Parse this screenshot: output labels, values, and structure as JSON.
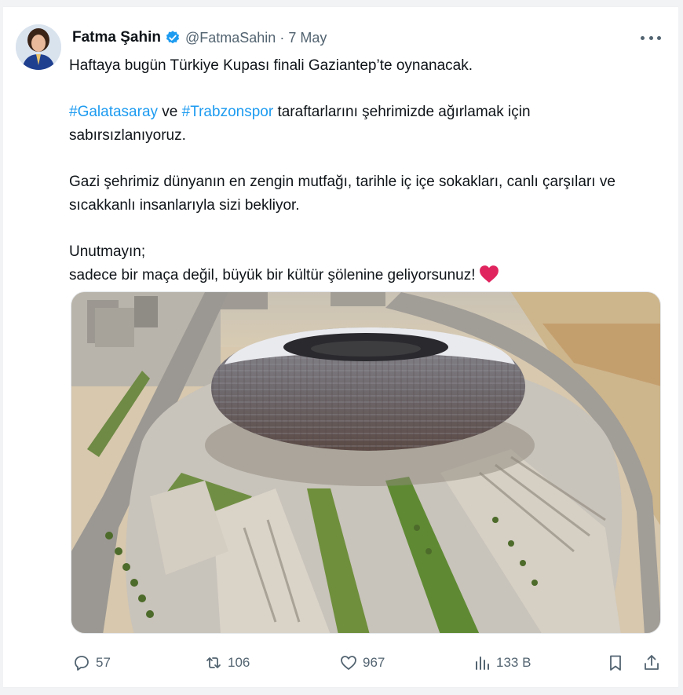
{
  "tweet": {
    "author_name": "Fatma Şahin",
    "handle": "@FatmaSahin",
    "separator": "·",
    "date": "7 May",
    "verified": true,
    "lines": {
      "p1": "Haftaya bugün Türkiye Kupası finali Gaziantep’te oynanacak.",
      "hashtag1": "#Galatasaray",
      "conj": " ve ",
      "hashtag2": "#Trabzonspor",
      "p2_rest": " taraftarlarını şehrimizde ağırlamak için sabırsızlanıyoruz.",
      "p3": "Gazi şehrimiz dünyanın en zengin mutfağı, tarihle iç içe sokakları, canlı çarşıları ve sıcakkanlı insanlarıyla sizi bekliyor.",
      "p4a": "Unutmayın;",
      "p4b": "sadece bir maça değil, büyük bir kültür şölenine geliyorsunuz!"
    }
  },
  "actions": {
    "replies": "57",
    "reposts": "106",
    "likes": "967",
    "views": "133 B"
  },
  "icons": [
    "verified-badge-icon",
    "more-icon",
    "heart-emoji-icon",
    "reply-icon",
    "repost-icon",
    "like-icon",
    "views-icon",
    "bookmark-icon",
    "share-icon"
  ],
  "colors": {
    "link": "#1d9bf0",
    "muted": "#536471",
    "verified": "#1d9bf0",
    "heart": "#e0245e"
  }
}
